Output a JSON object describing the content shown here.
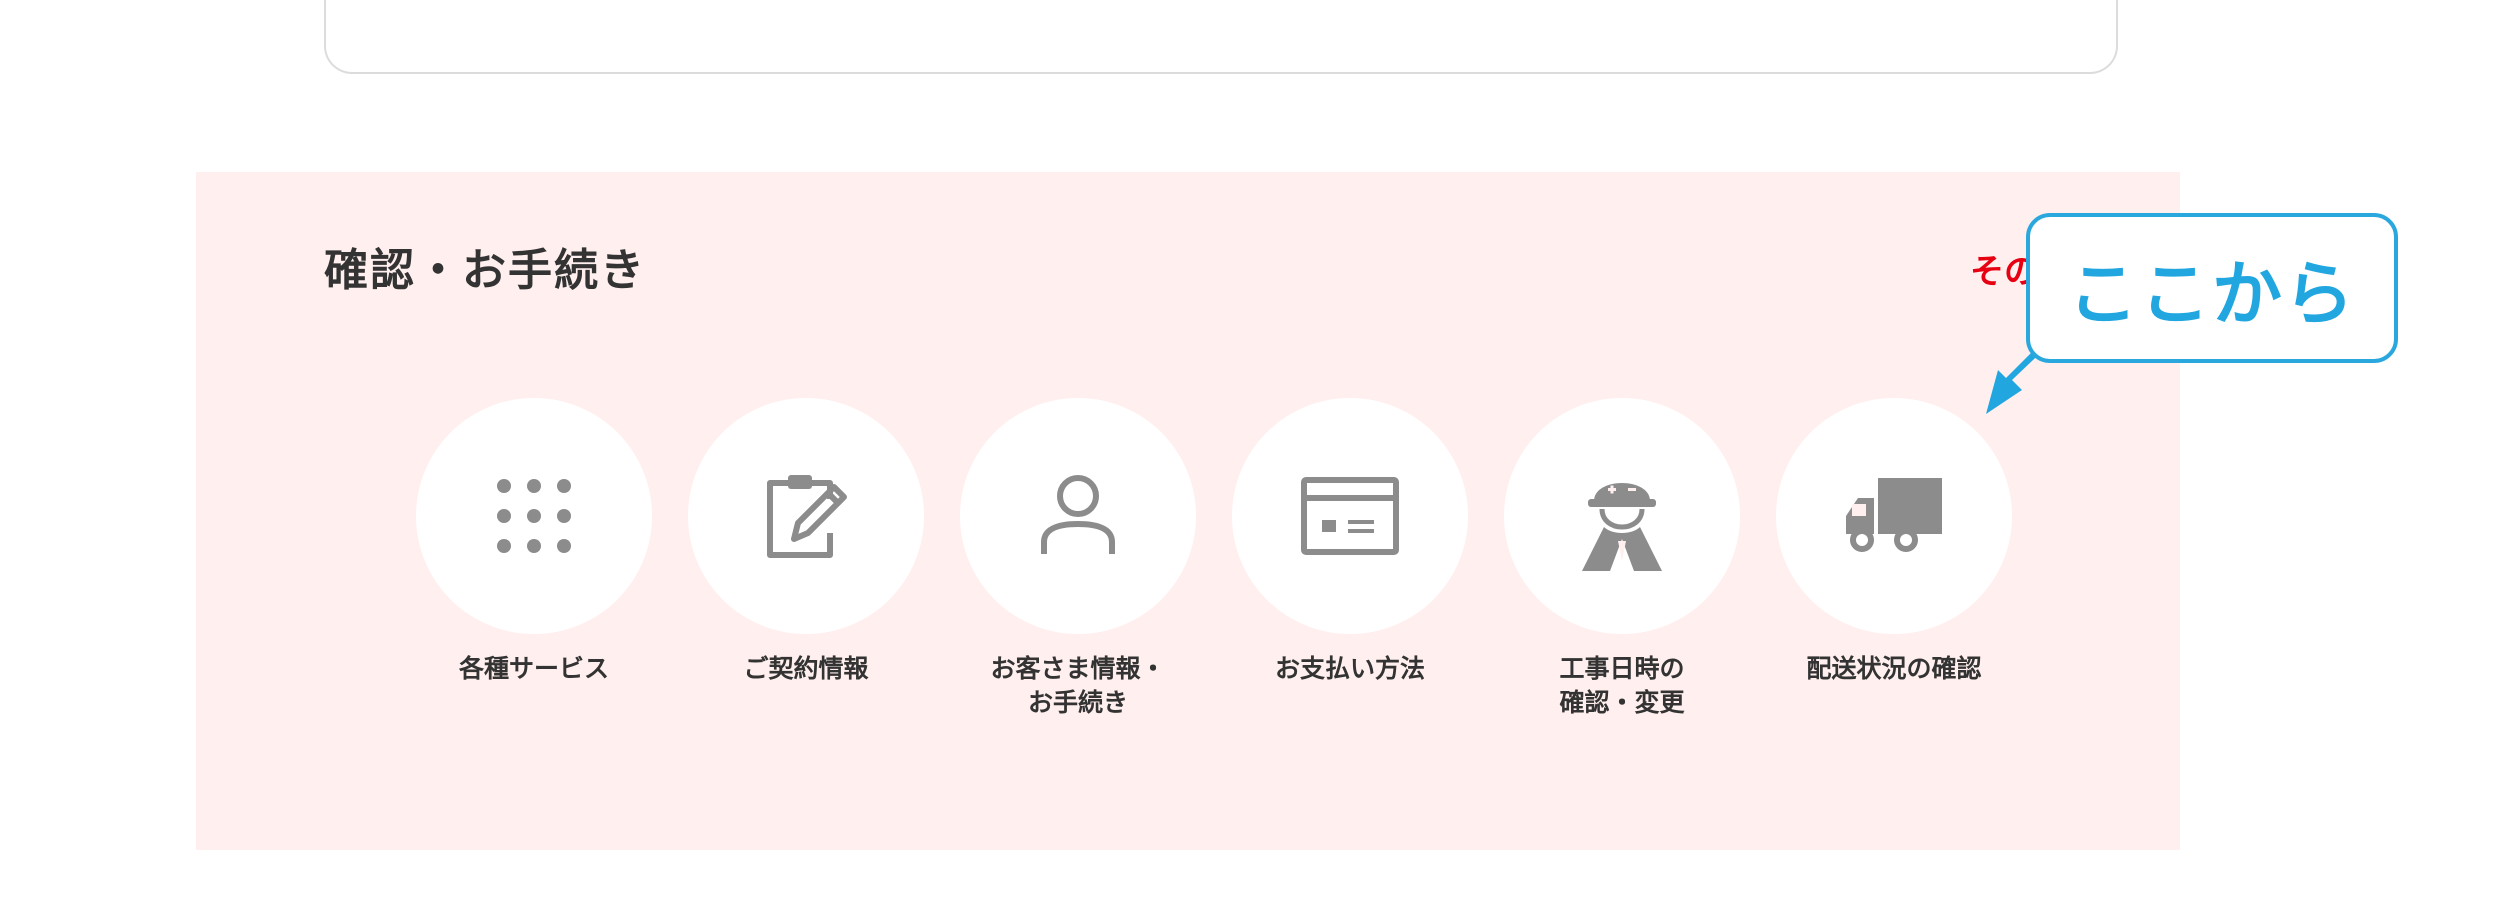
{
  "section": {
    "title": "確認・お手続き",
    "other_link": "その"
  },
  "services": [
    {
      "label": "各種サービス",
      "icon": "grid-dots-icon"
    },
    {
      "label": "ご契約情報",
      "icon": "clipboard-edit-icon"
    },
    {
      "label": "お客さま情報・\nお手続き",
      "icon": "person-icon"
    },
    {
      "label": "お支払い方法",
      "icon": "payment-card-icon"
    },
    {
      "label": "工事日時の\n確認・変更",
      "icon": "construction-worker-icon"
    },
    {
      "label": "配送状況の確認",
      "icon": "delivery-truck-icon"
    }
  ],
  "callout": {
    "text": "ここから"
  },
  "colors": {
    "section_bg": "#fff0ef",
    "accent_red": "#e60012",
    "callout_blue": "#22a6e0",
    "icon_gray": "#8c8c8c"
  }
}
